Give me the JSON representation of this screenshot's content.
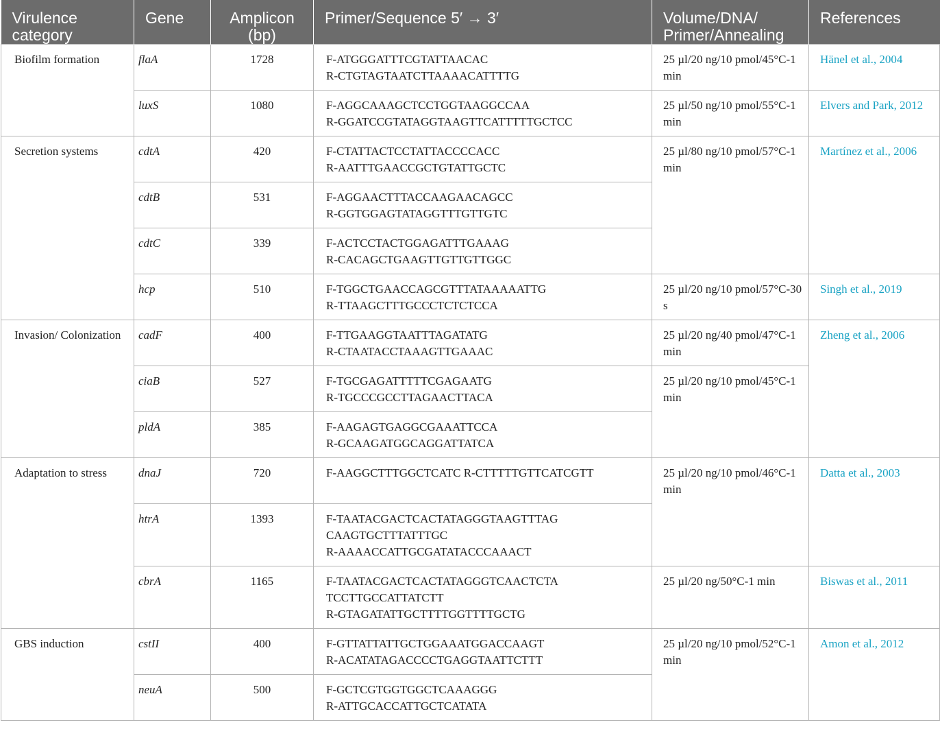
{
  "columns": [
    "Virulence category",
    "Gene",
    "Amplicon (bp)",
    "Primer/Sequence 5′ → 3′",
    "Volume/DNA/ Primer/Annealing",
    "References"
  ],
  "categories": [
    "Biofilm formation",
    "Secretion systems",
    "Invasion/ Colonization",
    "Adaptation to stress",
    "GBS induction"
  ],
  "rows": [
    {
      "gene": "flaA",
      "amplicon": "1728",
      "primer_f": "F-ATGGGATTTCGTATTAACAC",
      "primer_r": "R-CTGTAGTAATCTTAAAACATTTTG"
    },
    {
      "gene": "luxS",
      "amplicon": "1080",
      "primer_f": "F-AGGCAAAGCTCCTGGTAAGGCCAA",
      "primer_r": "R-GGATCCGTATAGGTAAGTTCATTTTTGCTCC"
    },
    {
      "gene": "cdtA",
      "amplicon": "420",
      "primer_f": "F-CTATTACTCCTATTACCCCACC",
      "primer_r": "R-AATTTGAACCGCTGTATTGCTC"
    },
    {
      "gene": "cdtB",
      "amplicon": "531",
      "primer_f": "F-AGGAACTTTACCAAGAACAGCC",
      "primer_r": "R-GGTGGAGTATAGGTTTGTTGTC"
    },
    {
      "gene": "cdtC",
      "amplicon": "339",
      "primer_f": "F-ACTCCTACTGGAGATTTGAAAG",
      "primer_r": "R-CACAGCTGAAGTTGTTGTTGGC"
    },
    {
      "gene": "hcp",
      "amplicon": "510",
      "primer_f": "F-TGGCTGAACCAGCGTTTATAAAAATTG",
      "primer_r": "R-TTAAGCTTTGCCCTCTCTCCA"
    },
    {
      "gene": "cadF",
      "amplicon": "400",
      "primer_f": "F-TTGAAGGTAATTTAGATATG",
      "primer_r": "R-CTAATACCTAAAGTTGAAAC"
    },
    {
      "gene": "ciaB",
      "amplicon": "527",
      "primer_f": "F-TGCGAGATTTTTCGAGAATG",
      "primer_r": "R-TGCCCGCCTTAGAACTTACA"
    },
    {
      "gene": "pldA",
      "amplicon": "385",
      "primer_f": "F-AAGAGTGAGGCGAAATTCCA",
      "primer_r": "R-GCAAGATGGCAGGATTATCA"
    },
    {
      "gene": "dnaJ",
      "amplicon": "720",
      "primer_f": "F-AAGGCTTTGGCTCATC R-CTTTTTGTTCATCGTT",
      "primer_r": ""
    },
    {
      "gene": "htrA",
      "amplicon": "1393",
      "primer_f": "F-TAATACGACTCACTATAGGGTAAGTTTAG",
      "primer_f2": "CAAGTGCTTTATTTGC",
      "primer_r": "R-AAAACCATTGCGATATACCCAAACT"
    },
    {
      "gene": "cbrA",
      "amplicon": "1165",
      "primer_f": "F-TAATACGACTCACTATAGGGTCAACTCTA",
      "primer_f2": "TCCTTGCCATTATCTT",
      "primer_r": "R-GTAGATATTGCTTTTGGTTTTGCTG"
    },
    {
      "gene": "cstII",
      "amplicon": "400",
      "primer_f": "F-GTTATTATTGCTGGAAATGGACCAAGT",
      "primer_r": "R-ACATATAGACCCCTGAGGTAATTCTTT"
    },
    {
      "gene": "neuA",
      "amplicon": "500",
      "primer_f": "F-GCTCGTGGTGGCTCAAAGGG",
      "primer_r": "R-ATTGCACCATTGCTCATATA"
    }
  ],
  "volume": [
    "25 µl/20 ng/10 pmol/45°C-1 min",
    "25 µl/50 ng/10 pmol/55°C-1 min",
    "25 µl/80 ng/10 pmol/57°C-1 min",
    "25 µl/20 ng/10 pmol/57°C-30 s",
    "25 µl/20 ng/40 pmol/47°C-1 min",
    "25 µl/20 ng/10 pmol/45°C-1 min",
    "25 µl/20 ng/10 pmol/46°C-1 min",
    "25 µl/20 ng/50°C-1 min",
    "25 µl/20 ng/10 pmol/52°C-1 min"
  ],
  "references": [
    "Hänel et al., 2004",
    "Elvers and Park, 2012",
    "Martínez et al., 2006",
    "Singh et al., 2019",
    "Zheng et al., 2006",
    "Datta et al., 2003",
    "Biswas et al., 2011",
    "Amon et al., 2012"
  ],
  "colors": {
    "header_bg": "#6c6c6c",
    "header_text": "#ffffff",
    "reference_link": "#1aa3c4",
    "grid_line": "#b4b4b4"
  }
}
